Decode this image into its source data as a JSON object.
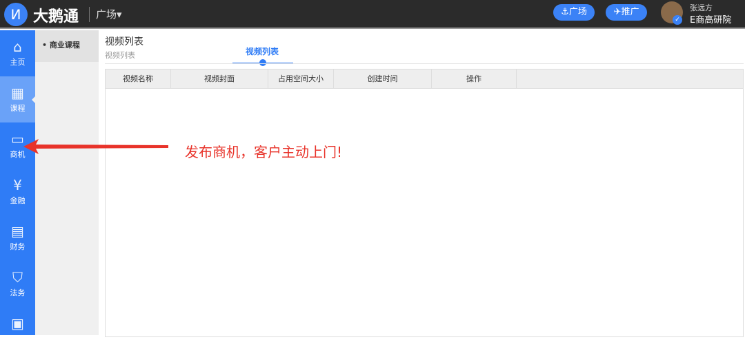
{
  "header": {
    "brand": "大鹅通",
    "square_menu": "广场▾",
    "btn_square": "⚓广场",
    "btn_promote": "✈推广",
    "user_name": "张远方",
    "org": "E商高研院"
  },
  "sidebar": {
    "items": [
      {
        "label": "主页",
        "icon": "⌂"
      },
      {
        "label": "课程",
        "icon": "▦"
      },
      {
        "label": "商机",
        "icon": "▭"
      },
      {
        "label": "金融",
        "icon": "¥"
      },
      {
        "label": "财务",
        "icon": "▤"
      },
      {
        "label": "法务",
        "icon": "⛉"
      },
      {
        "label": "",
        "icon": "▣"
      }
    ]
  },
  "submenu": {
    "item": "商业课程"
  },
  "main": {
    "title": "视频列表",
    "subtitle": "视频列表",
    "tab": "视频列表",
    "columns": [
      "视频名称",
      "视频封面",
      "占用空间大小",
      "创建时间",
      "操作"
    ]
  },
  "annotation": "发布商机，客户主动上门!",
  "colors": {
    "accent": "#2f7cf6",
    "annotation": "#e8332a"
  }
}
